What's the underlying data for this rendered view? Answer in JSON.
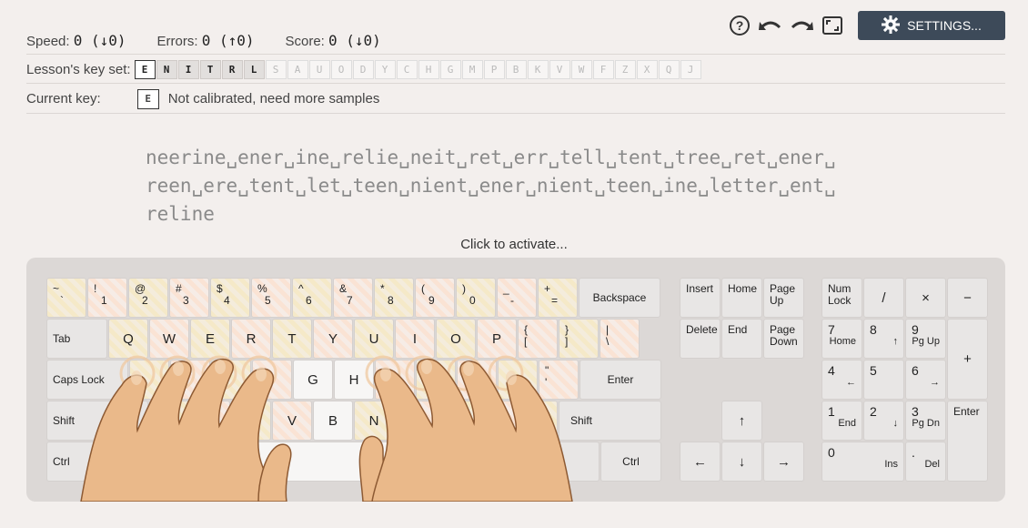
{
  "toolbar": {
    "help_icon": "question-circle-icon",
    "undo_icon": "undo-icon",
    "redo_icon": "redo-icon",
    "fullscreen_icon": "fullscreen-icon",
    "settings_label": "SETTINGS..."
  },
  "stats": {
    "speed_label": "Speed:",
    "speed_value": "0 (↓0)",
    "errors_label": "Errors:",
    "errors_value": "0 (↑0)",
    "score_label": "Score:",
    "score_value": "0 (↓0)"
  },
  "keyset": {
    "label": "Lesson's key set:",
    "keys": [
      "E",
      "N",
      "I",
      "T",
      "R",
      "L",
      "S",
      "A",
      "U",
      "O",
      "D",
      "Y",
      "C",
      "H",
      "G",
      "M",
      "P",
      "B",
      "K",
      "V",
      "W",
      "F",
      "Z",
      "X",
      "Q",
      "J"
    ],
    "included_count": 6,
    "current": "E"
  },
  "current_key": {
    "label": "Current key:",
    "key": "E",
    "status": "Not calibrated, need more samples"
  },
  "lesson": {
    "line1": "neerine␣ener␣ine␣relie␣neit␣ret␣err␣tell␣tent␣tree␣ret␣ener␣",
    "line2": "reen␣ere␣tent␣let␣teen␣nient␣ener␣nient␣teen␣ine␣letter␣ent␣",
    "line3": "reline"
  },
  "activate_text": "Click to activate...",
  "keyboard": {
    "row1": [
      [
        "~",
        "`"
      ],
      [
        "!",
        "1"
      ],
      [
        "@",
        "2"
      ],
      [
        "#",
        "3"
      ],
      [
        "$",
        "4"
      ],
      [
        "%",
        "5"
      ],
      [
        "^",
        "6"
      ],
      [
        "&",
        "7"
      ],
      [
        "*",
        "8"
      ],
      [
        "(",
        "9"
      ],
      [
        ")",
        "0"
      ],
      [
        "_",
        "-"
      ],
      [
        "+",
        "="
      ]
    ],
    "backspace": "Backspace",
    "tab": "Tab",
    "row2": [
      "Q",
      "W",
      "E",
      "R",
      "T",
      "Y",
      "U",
      "I",
      "O",
      "P"
    ],
    "row2_sym": [
      [
        "{",
        "["
      ],
      [
        "}",
        "]"
      ],
      [
        "|",
        "\\"
      ]
    ],
    "caps": "Caps Lock",
    "row3_visible": [
      "G",
      "H"
    ],
    "row3_sym": [
      "\"",
      "'"
    ],
    "enter": "Enter",
    "shift": "Shift",
    "row4_visible": [
      "X",
      "V",
      "B",
      "N"
    ],
    "ctrl": "Ctrl",
    "nav": {
      "insert": "Insert",
      "home": "Home",
      "page_up": "Page Up",
      "delete": "Delete",
      "end": "End",
      "page_down": "Page Down",
      "up": "↑",
      "left": "←",
      "down": "↓",
      "right": "→"
    },
    "numpad": {
      "numlock": "Num Lock",
      "div": "/",
      "mul": "×",
      "sub": "−",
      "n7": [
        "7",
        "Home"
      ],
      "n8": [
        "8",
        "↑"
      ],
      "n9": [
        "9",
        "Pg Up"
      ],
      "add": "+",
      "n4": [
        "4",
        "←"
      ],
      "n5": "5",
      "n6": [
        "6",
        "→"
      ],
      "n1": [
        "1",
        "End"
      ],
      "n2": [
        "2",
        "↓"
      ],
      "n3": [
        "3",
        "Pg Dn"
      ],
      "enter": "Enter",
      "n0": [
        "0",
        "Ins"
      ],
      "dot": [
        ".",
        "Del"
      ]
    }
  }
}
